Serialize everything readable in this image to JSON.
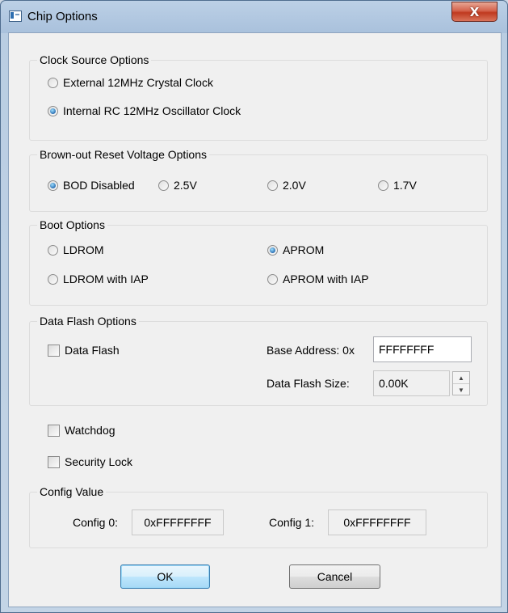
{
  "window": {
    "title": "Chip Options",
    "close_glyph": "X"
  },
  "clock": {
    "title": "Clock Source Options",
    "options": [
      "External 12MHz Crystal Clock",
      "Internal RC 12MHz Oscillator Clock"
    ],
    "selected": 1
  },
  "brownout": {
    "title": "Brown-out Reset Voltage Options",
    "options": [
      "BOD Disabled",
      "2.5V",
      "2.0V",
      "1.7V"
    ],
    "selected": 0
  },
  "boot": {
    "title": "Boot Options",
    "options": [
      "LDROM",
      "APROM",
      "LDROM with IAP",
      "APROM with IAP"
    ],
    "selected": 1
  },
  "dataflash": {
    "title": "Data Flash Options",
    "checkbox_label": "Data Flash",
    "checked": false,
    "base_label": "Base Address: 0x",
    "base_value": "FFFFFFFF",
    "size_label": "Data Flash Size:",
    "size_value": "0.00K"
  },
  "watchdog": {
    "label": "Watchdog",
    "checked": false
  },
  "security": {
    "label": "Security Lock",
    "checked": false
  },
  "config": {
    "title": "Config Value",
    "config0_label": "Config 0:",
    "config0_value": "0xFFFFFFFF",
    "config1_label": "Config 1:",
    "config1_value": "0xFFFFFFFF"
  },
  "buttons": {
    "ok": "OK",
    "cancel": "Cancel"
  },
  "colors": {
    "accent": "#3c7fb1",
    "close": "#c0391f",
    "dialog_bg": "#f0f0f0"
  }
}
